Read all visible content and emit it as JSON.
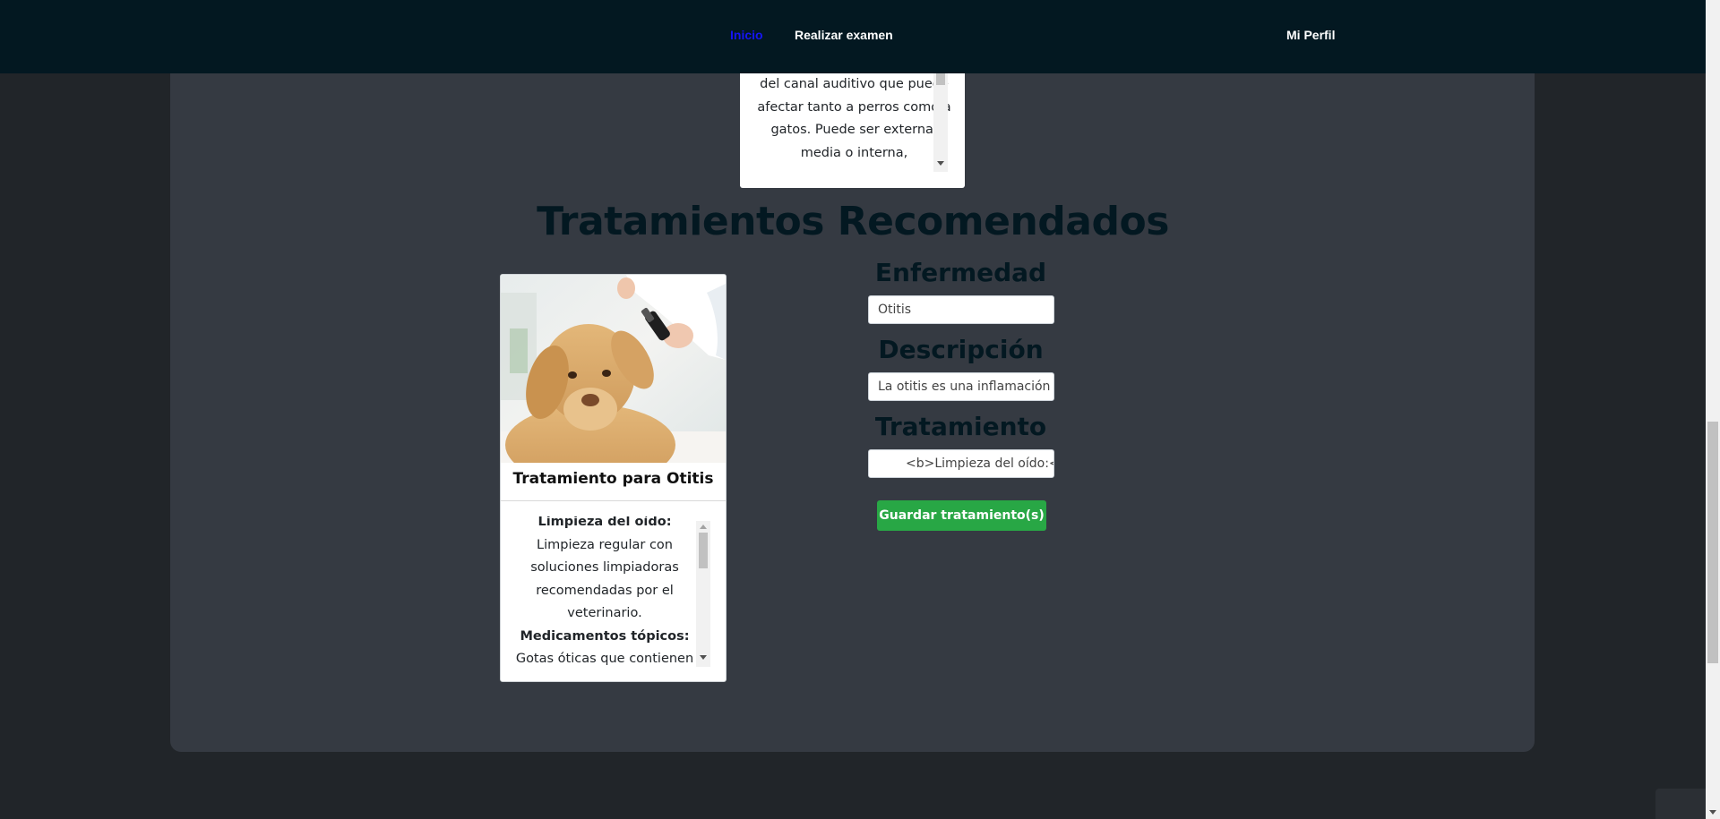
{
  "nav": {
    "home": "Inicio",
    "exam": "Realizar examen",
    "profile": "Mi Perfil"
  },
  "top_card": {
    "lines": [
      "del canal auditivo que puede",
      "afectar tanto a perros como a",
      "gatos. Puede ser externa,",
      "media o interna,"
    ]
  },
  "section": {
    "title": "Tratamientos Recomendados"
  },
  "treatment_card": {
    "title": "Tratamiento para Otitis",
    "items": [
      {
        "heading": "Limpieza del oído:",
        "text": " Limpieza regular con soluciones limpiadoras recomendadas por el veterinario."
      },
      {
        "heading": "Medicamentos tópicos:",
        "text": " Gotas óticas que contienen antibióticos, antifúngicos o"
      }
    ]
  },
  "form": {
    "disease_label": "Enfermedad",
    "disease_value": "Otitis",
    "description_label": "Descripción",
    "description_value": "La otitis es una inflamación",
    "treatment_label": "Tratamiento",
    "treatment_value": "<b>Limpieza del oído:<",
    "save_label": "Guardar tratamiento(s)"
  },
  "colors": {
    "navbar": "#031821",
    "page_bg": "#212529",
    "card_bg": "#353a42",
    "active_link": "#1515f5",
    "button": "#28a745",
    "heading": "#031821"
  },
  "icons": [
    "scroll-arrow-up-icon",
    "scroll-arrow-down-icon"
  ]
}
